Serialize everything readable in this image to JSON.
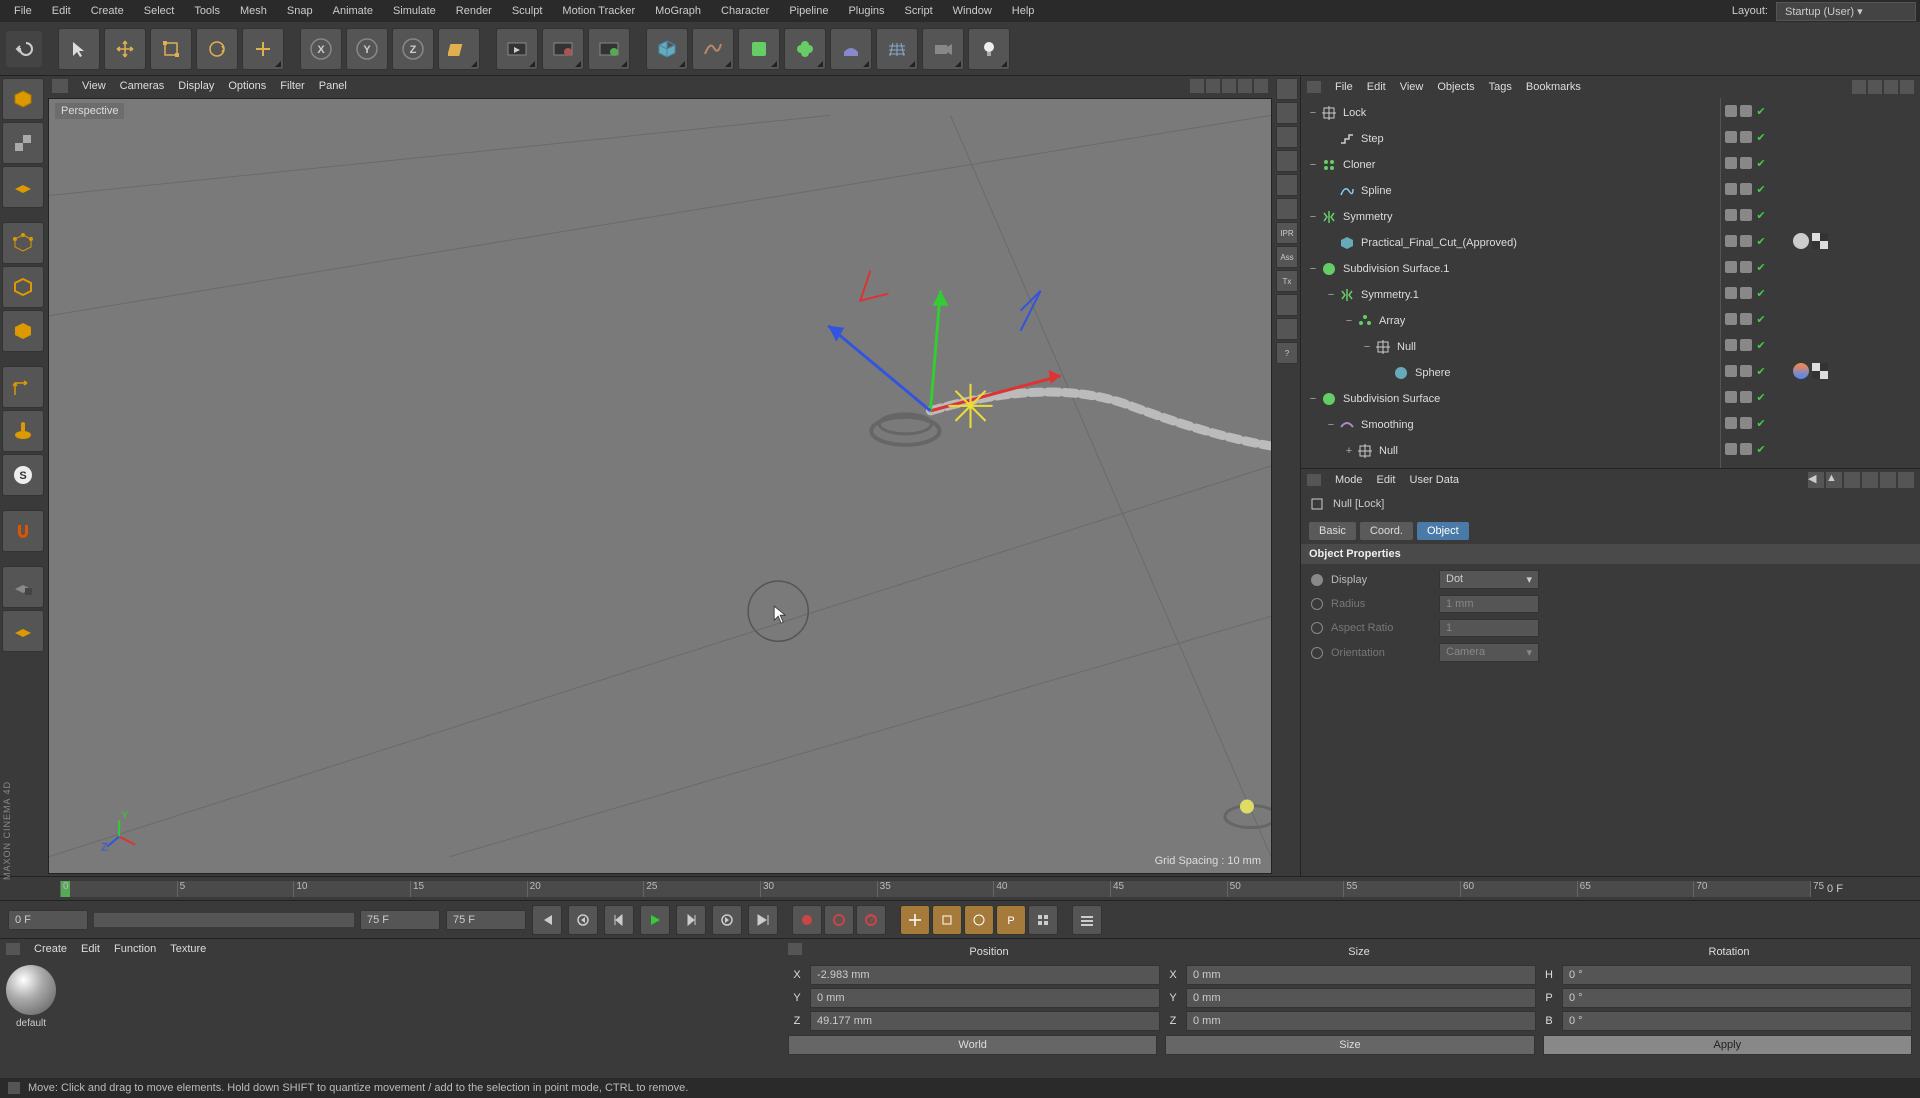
{
  "menubar": [
    "File",
    "Edit",
    "Create",
    "Select",
    "Tools",
    "Mesh",
    "Snap",
    "Animate",
    "Simulate",
    "Render",
    "Sculpt",
    "Motion Tracker",
    "MoGraph",
    "Character",
    "Pipeline",
    "Plugins",
    "Script",
    "Window",
    "Help"
  ],
  "layout": {
    "label": "Layout:",
    "value": "Startup (User)"
  },
  "view_menubar": [
    "View",
    "Cameras",
    "Display",
    "Options",
    "Filter",
    "Panel"
  ],
  "viewport": {
    "perspective": "Perspective",
    "grid": "Grid Spacing : 10 mm"
  },
  "right_toolcol": [
    "",
    "",
    "",
    "",
    "",
    "",
    "IPR",
    "Ass",
    "Tx",
    "",
    "",
    "?"
  ],
  "obj_menubar": [
    "File",
    "Edit",
    "View",
    "Objects",
    "Tags",
    "Bookmarks"
  ],
  "tree": [
    {
      "indent": 0,
      "expand": "−",
      "icon": "null",
      "label": "Lock",
      "enabled": true,
      "tags": []
    },
    {
      "indent": 1,
      "expand": "",
      "icon": "step",
      "label": "Step",
      "enabled": true,
      "tags": []
    },
    {
      "indent": 0,
      "expand": "−",
      "icon": "cloner",
      "label": "Cloner",
      "enabled": true,
      "tags": []
    },
    {
      "indent": 1,
      "expand": "",
      "icon": "spline",
      "label": "Spline",
      "enabled": true,
      "tags": []
    },
    {
      "indent": 0,
      "expand": "−",
      "icon": "symmetry",
      "label": "Symmetry",
      "enabled": true,
      "tags": []
    },
    {
      "indent": 1,
      "expand": "",
      "icon": "obj",
      "label": "Practical_Final_Cut_(Approved)",
      "enabled": true,
      "tags": [
        "sphere",
        "check"
      ]
    },
    {
      "indent": 0,
      "expand": "−",
      "icon": "subdiv",
      "label": "Subdivision Surface.1",
      "enabled": true,
      "tags": []
    },
    {
      "indent": 1,
      "expand": "−",
      "icon": "symmetry",
      "label": "Symmetry.1",
      "enabled": true,
      "tags": []
    },
    {
      "indent": 2,
      "expand": "−",
      "icon": "array",
      "label": "Array",
      "enabled": true,
      "tags": []
    },
    {
      "indent": 3,
      "expand": "−",
      "icon": "null",
      "label": "Null",
      "enabled": true,
      "tags": []
    },
    {
      "indent": 4,
      "expand": "",
      "icon": "sphere",
      "label": "Sphere",
      "enabled": true,
      "tags": [
        "grad",
        "check"
      ]
    },
    {
      "indent": 0,
      "expand": "−",
      "icon": "subdiv",
      "label": "Subdivision Surface",
      "enabled": true,
      "tags": []
    },
    {
      "indent": 1,
      "expand": "−",
      "icon": "smooth",
      "label": "Smoothing",
      "enabled": true,
      "tags": []
    },
    {
      "indent": 2,
      "expand": "+",
      "icon": "null",
      "label": "Null",
      "enabled": true,
      "tags": []
    }
  ],
  "attr_menubar": [
    "Mode",
    "Edit",
    "User Data"
  ],
  "attr_header": "Null [Lock]",
  "attr_tabs": [
    "Basic",
    "Coord.",
    "Object"
  ],
  "attr_active_tab": 2,
  "attr_section": "Object Properties",
  "attr_props": {
    "display": {
      "label": "Display",
      "value": "Dot",
      "enabled": true
    },
    "radius": {
      "label": "Radius",
      "value": "1 mm",
      "enabled": false
    },
    "aspect": {
      "label": "Aspect Ratio",
      "value": "1",
      "enabled": false
    },
    "orient": {
      "label": "Orientation",
      "value": "Camera",
      "enabled": false
    }
  },
  "timeline": {
    "ticks": [
      "0",
      "5",
      "10",
      "15",
      "20",
      "25",
      "30",
      "35",
      "40",
      "45",
      "50",
      "55",
      "60",
      "65",
      "70",
      "75"
    ],
    "end_label": "0 F",
    "start_frame": "0 F",
    "slider_start": "0 F",
    "slider_end": "75 F",
    "current": "75 F"
  },
  "mat_menubar": [
    "Create",
    "Edit",
    "Function",
    "Texture"
  ],
  "mat_default": "default",
  "coord": {
    "headers": [
      "Position",
      "Size",
      "Rotation"
    ],
    "rows": [
      {
        "axis": "X",
        "pos": "-2.983 mm",
        "saxis": "X",
        "size": "0 mm",
        "raxis": "H",
        "rot": "0 °"
      },
      {
        "axis": "Y",
        "pos": "0 mm",
        "saxis": "Y",
        "size": "0 mm",
        "raxis": "P",
        "rot": "0 °"
      },
      {
        "axis": "Z",
        "pos": "49.177 mm",
        "saxis": "Z",
        "size": "0 mm",
        "raxis": "B",
        "rot": "0 °"
      }
    ],
    "world": "World",
    "size_mode": "Size",
    "apply": "Apply"
  },
  "status": "Move: Click and drag to move elements. Hold down SHIFT to quantize movement / add to the selection in point mode, CTRL to remove.",
  "side_brand": "MAXON CINEMA 4D"
}
